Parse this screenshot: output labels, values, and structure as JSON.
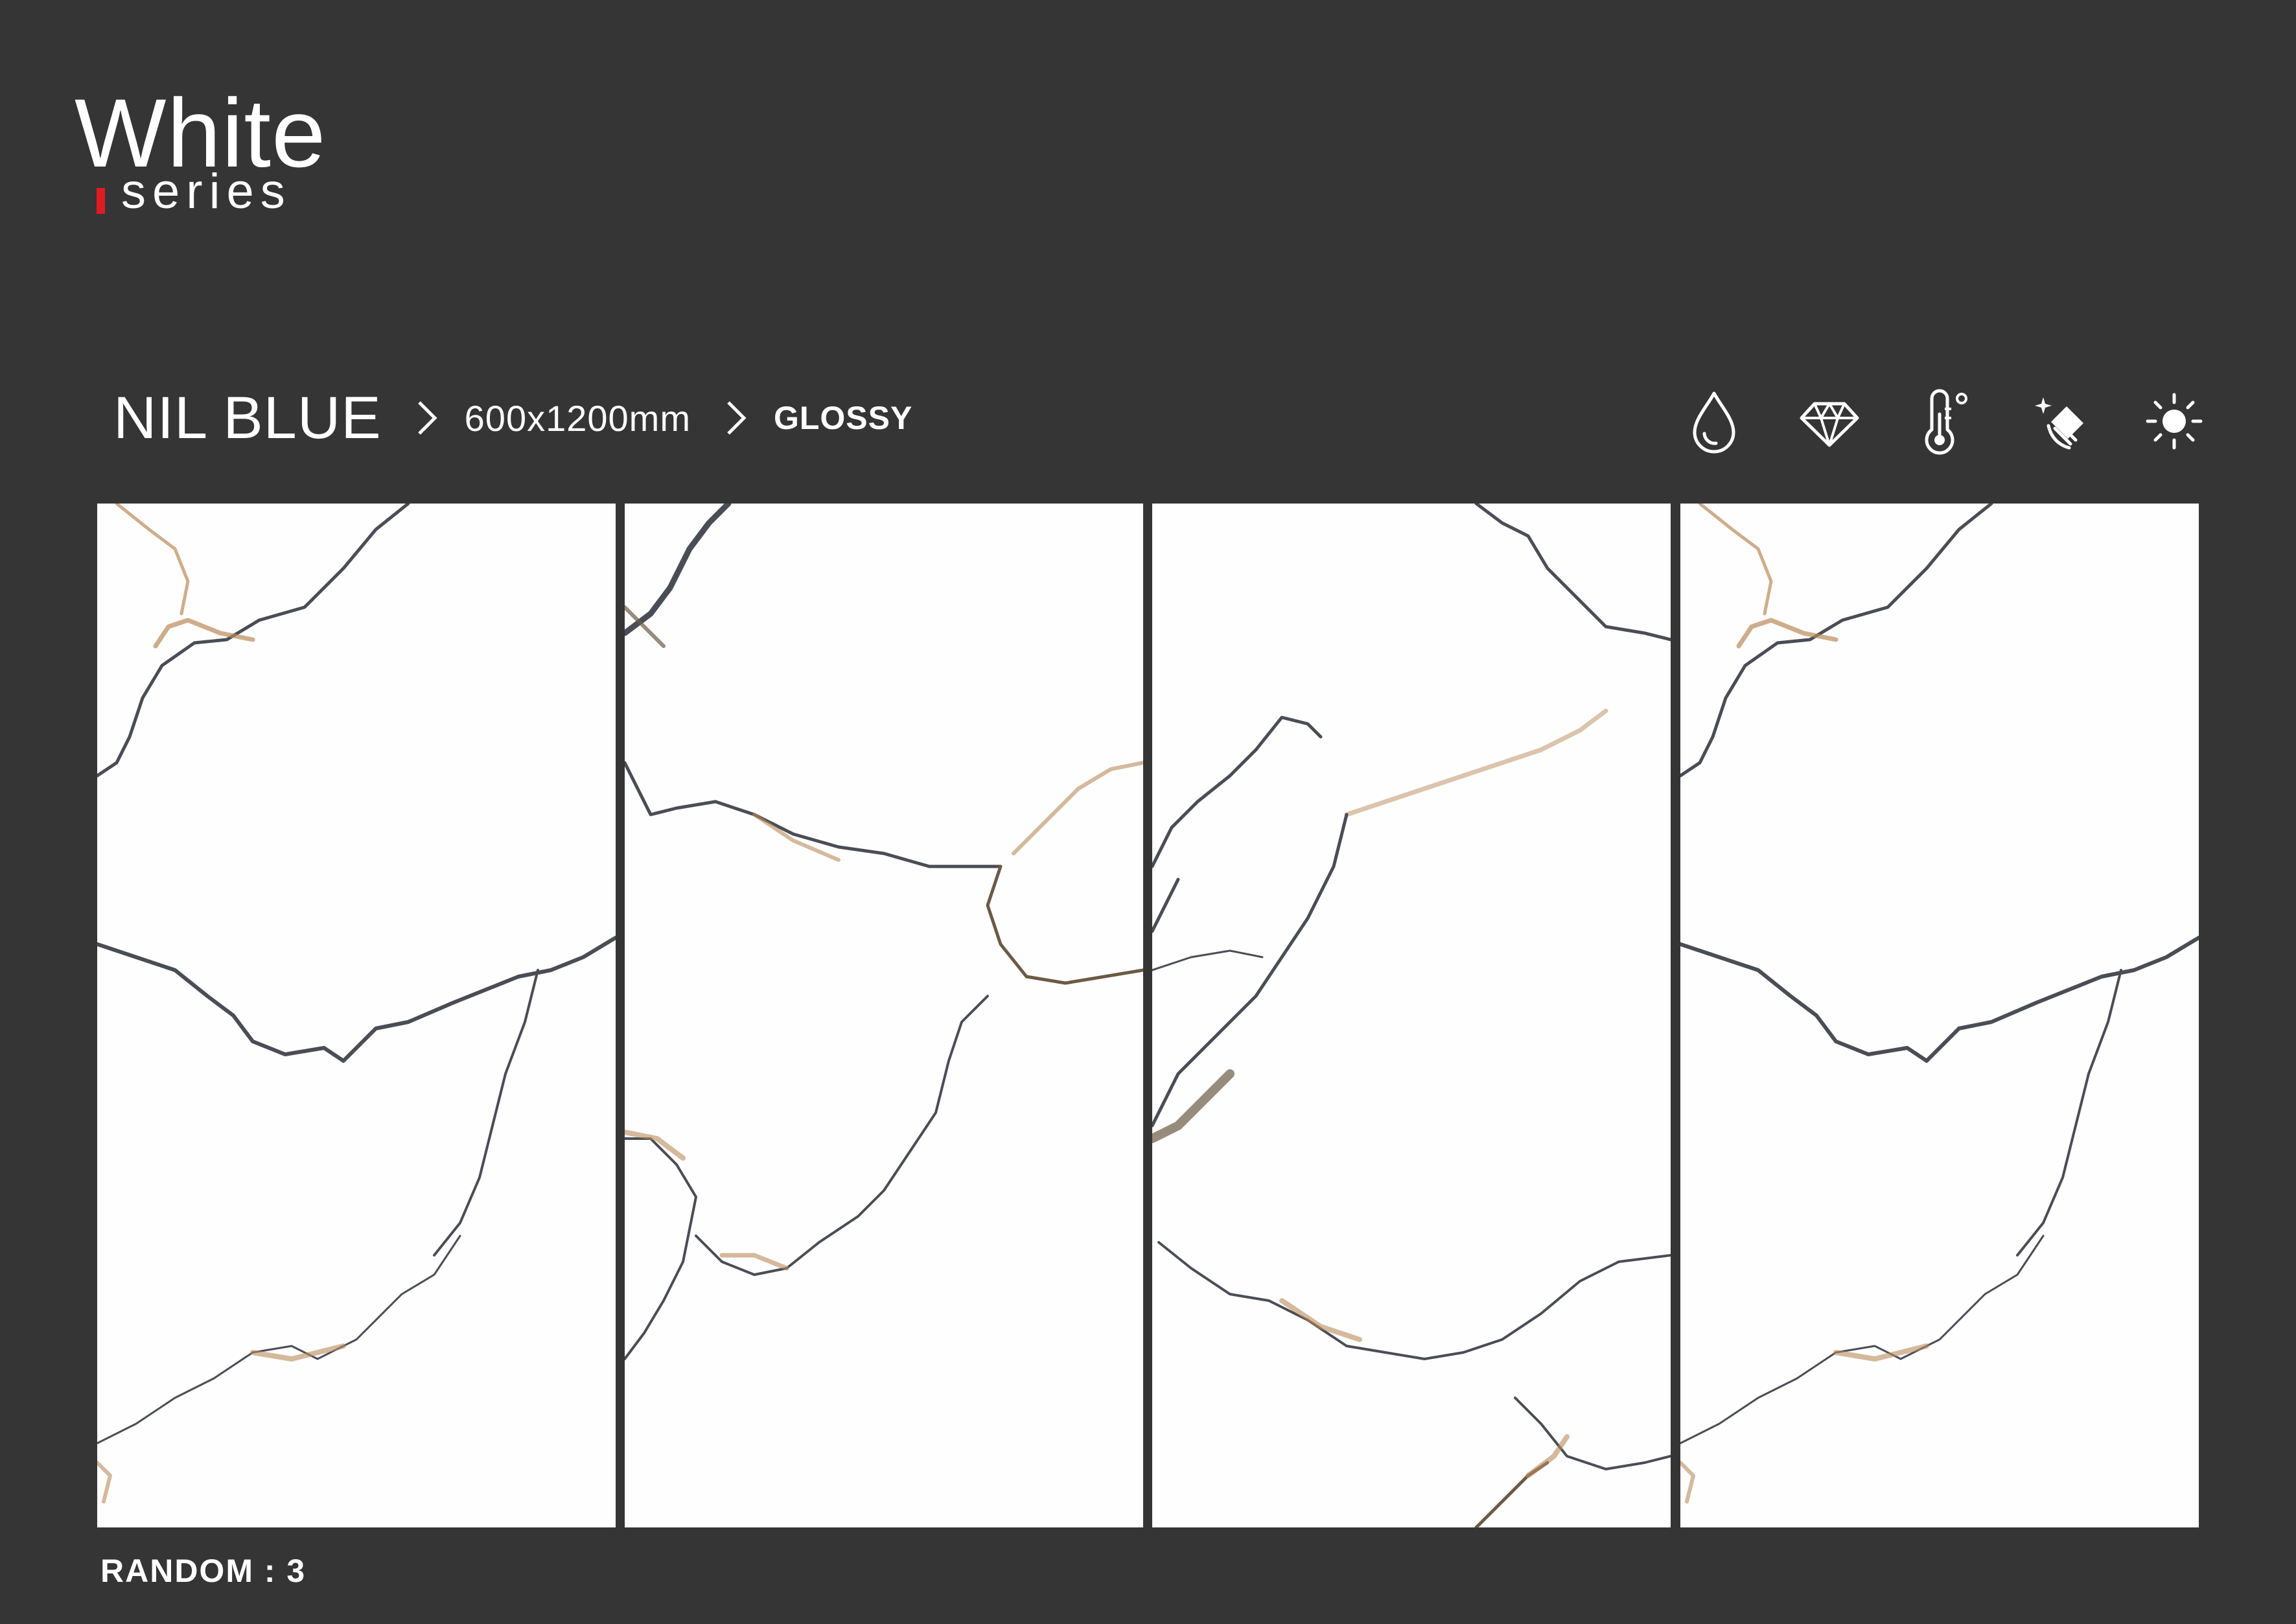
{
  "brand": {
    "title": "White",
    "subtitle": "series",
    "accent_color": "#e01b22"
  },
  "breadcrumb": {
    "product": "NIL BLUE",
    "size": "600x1200mm",
    "finish": "GLOSSY"
  },
  "feature_icons": [
    "water-drop-icon",
    "diamond-icon",
    "thermometer-icon",
    "cleaning-icon",
    "sun-icon"
  ],
  "tiles": {
    "count": 4
  },
  "footer": {
    "random_label": "RANDOM : 3"
  },
  "colors": {
    "background": "#353535",
    "tile": "#fefefe",
    "vein_dark": "#4a4d55",
    "vein_gold": "#b98a5a"
  }
}
